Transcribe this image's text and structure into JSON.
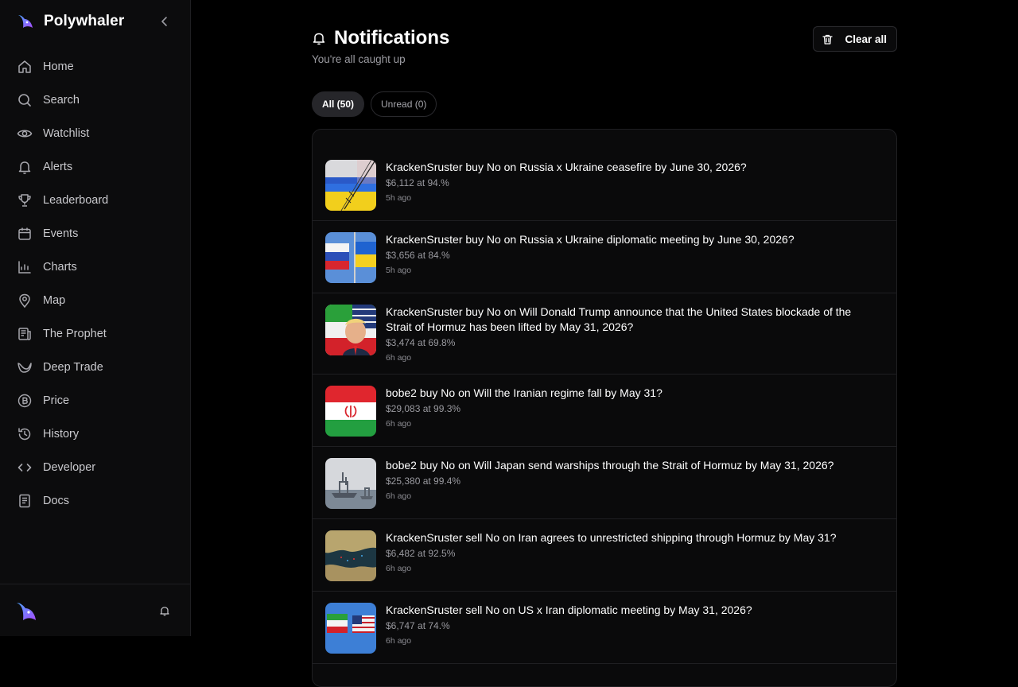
{
  "app": {
    "name": "Polywhaler"
  },
  "sidebar": {
    "items": [
      {
        "label": "Home",
        "icon": "home-icon"
      },
      {
        "label": "Search",
        "icon": "search-icon"
      },
      {
        "label": "Watchlist",
        "icon": "eye-icon"
      },
      {
        "label": "Alerts",
        "icon": "bell-icon"
      },
      {
        "label": "Leaderboard",
        "icon": "trophy-icon"
      },
      {
        "label": "Events",
        "icon": "calendar-icon"
      },
      {
        "label": "Charts",
        "icon": "chart-icon"
      },
      {
        "label": "Map",
        "icon": "map-pin-icon"
      },
      {
        "label": "The Prophet",
        "icon": "newspaper-icon"
      },
      {
        "label": "Deep Trade",
        "icon": "whale-icon"
      },
      {
        "label": "Price",
        "icon": "bitcoin-icon"
      },
      {
        "label": "History",
        "icon": "history-icon"
      },
      {
        "label": "Developer",
        "icon": "code-icon"
      },
      {
        "label": "Docs",
        "icon": "book-icon"
      }
    ]
  },
  "header": {
    "title": "Notifications",
    "subtitle": "You're all caught up",
    "clear_label": "Clear all"
  },
  "tabs": [
    {
      "label": "All (50)",
      "active": true
    },
    {
      "label": "Unread (0)",
      "active": false
    }
  ],
  "notifications": [
    {
      "title": "KrackenSruster buy No on Russia x Ukraine ceasefire by June 30, 2026?",
      "amount": "$6,112 at 94.%",
      "time": "5h ago",
      "thumb": "russia-ukraine-flag"
    },
    {
      "title": "KrackenSruster buy No on Russia x Ukraine diplomatic meeting by June 30, 2026?",
      "amount": "$3,656 at 84.%",
      "time": "5h ago",
      "thumb": "russia-ukraine-flags"
    },
    {
      "title": "KrackenSruster buy No on Will Donald Trump announce that the United States blockade of the Strait of Hormuz has been lifted by May 31, 2026?",
      "amount": "$3,474 at 69.8%",
      "time": "6h ago",
      "thumb": "trump-iran"
    },
    {
      "title": "bobe2 buy No on Will the Iranian regime fall by May 31?",
      "amount": "$29,083 at 99.3%",
      "time": "6h ago",
      "thumb": "iran-flag"
    },
    {
      "title": "bobe2 buy No on Will Japan send warships through the Strait of Hormuz by May 31, 2026?",
      "amount": "$25,380 at 99.4%",
      "time": "6h ago",
      "thumb": "warships"
    },
    {
      "title": "KrackenSruster sell No on Iran agrees to unrestricted shipping through Hormuz by May 31?",
      "amount": "$6,482 at 92.5%",
      "time": "6h ago",
      "thumb": "strait-map"
    },
    {
      "title": "KrackenSruster sell No on US x Iran diplomatic meeting by May 31, 2026?",
      "amount": "$6,747 at 74.%",
      "time": "6h ago",
      "thumb": "us-iran-flags"
    }
  ]
}
